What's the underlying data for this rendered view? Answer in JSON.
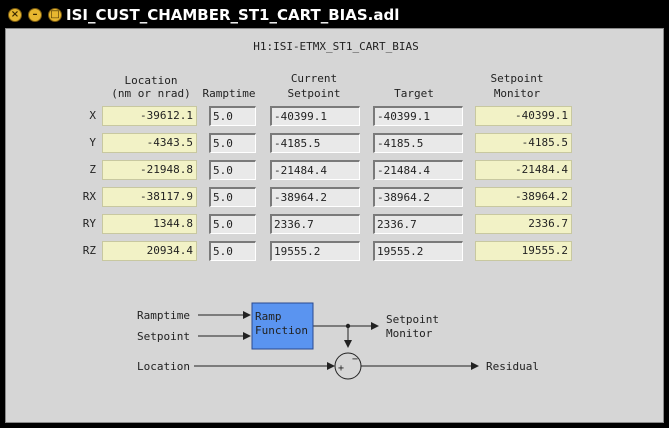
{
  "window": {
    "title": "ISI_CUST_CHAMBER_ST1_CART_BIAS.adl"
  },
  "panel": {
    "channel": "H1:ISI-ETMX_ST1_CART_BIAS"
  },
  "headers": {
    "location_1": "Location",
    "location_2": "(nm or nrad)",
    "ramptime": "Ramptime",
    "current_1": "Current",
    "current_2": "Setpoint",
    "target": "Target",
    "monitor_1": "Setpoint",
    "monitor_2": "Monitor"
  },
  "rows": [
    {
      "axis": "X",
      "location": "-39612.1",
      "ramptime": "5.0",
      "current": "-40399.1",
      "target": "-40399.1",
      "monitor": "-40399.1"
    },
    {
      "axis": "Y",
      "location": "-4343.5",
      "ramptime": "5.0",
      "current": "-4185.5",
      "target": "-4185.5",
      "monitor": "-4185.5"
    },
    {
      "axis": "Z",
      "location": "-21948.8",
      "ramptime": "5.0",
      "current": "-21484.4",
      "target": "-21484.4",
      "monitor": "-21484.4"
    },
    {
      "axis": "RX",
      "location": "-38117.9",
      "ramptime": "5.0",
      "current": "-38964.2",
      "target": "-38964.2",
      "monitor": "-38964.2"
    },
    {
      "axis": "RY",
      "location": "1344.8",
      "ramptime": "5.0",
      "current": "2336.7",
      "target": "2336.7",
      "monitor": "2336.7"
    },
    {
      "axis": "RZ",
      "location": "20934.4",
      "ramptime": "5.0",
      "current": "19555.2",
      "target": "19555.2",
      "monitor": "19555.2"
    }
  ],
  "diagram": {
    "ramptime": "Ramptime",
    "setpoint": "Setpoint",
    "location": "Location",
    "block_1": "Ramp",
    "block_2": "Function",
    "out_1": "Setpoint",
    "out_2": "Monitor",
    "residual": "Residual",
    "minus": "−",
    "plus": "+"
  },
  "colors": {
    "block": "#5a94f0",
    "field_yellow": "#f2f2c6",
    "panel": "#d6d6d6"
  }
}
